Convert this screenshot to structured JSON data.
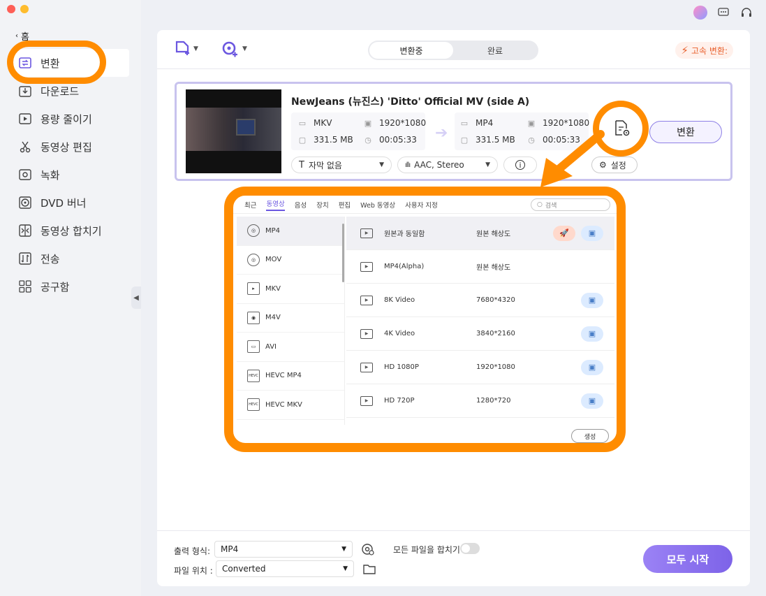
{
  "sidebar": {
    "home_label": "홈",
    "items": [
      {
        "label": "변환",
        "icon": "convert-icon"
      },
      {
        "label": "다운로드",
        "icon": "download-icon"
      },
      {
        "label": "용량 줄이기",
        "icon": "compress-icon"
      },
      {
        "label": "동영상 편집",
        "icon": "scissors-icon"
      },
      {
        "label": "녹화",
        "icon": "record-icon"
      },
      {
        "label": "DVD 버너",
        "icon": "disc-icon"
      },
      {
        "label": "동영상 합치기",
        "icon": "merge-icon"
      },
      {
        "label": "전송",
        "icon": "transfer-icon"
      },
      {
        "label": "공구함",
        "icon": "toolbox-icon"
      }
    ]
  },
  "toolbar": {
    "tabs": [
      "변환중",
      "완료"
    ],
    "turbo_label": "고속 변환:"
  },
  "file": {
    "title": "NewJeans (뉴진스) 'Ditto' Official MV (side A)",
    "source": {
      "format": "MKV",
      "resolution": "1920*1080",
      "size": "331.5 MB",
      "duration": "00:05:33"
    },
    "target": {
      "format": "MP4",
      "resolution": "1920*1080",
      "size": "331.5 MB",
      "duration": "00:05:33"
    },
    "subtitle": "자막 없음",
    "audio": "AAC, Stereo",
    "settings_label": "설정",
    "convert_label": "변환"
  },
  "popup": {
    "tabs": [
      "최근",
      "동영상",
      "음성",
      "장치",
      "편집",
      "Web 동영상",
      "사용자 지정"
    ],
    "active_tab": "동영상",
    "search_placeholder": "검색",
    "formats": [
      "MP4",
      "MOV",
      "MKV",
      "M4V",
      "AVI",
      "HEVC MP4",
      "HEVC MKV"
    ],
    "resolutions": [
      {
        "name": "원본과 동일함",
        "res": "원본 해상도"
      },
      {
        "name": "MP4(Alpha)",
        "res": "원본 해상도"
      },
      {
        "name": "8K Video",
        "res": "7680*4320"
      },
      {
        "name": "4K Video",
        "res": "3840*2160"
      },
      {
        "name": "HD 1080P",
        "res": "1920*1080"
      },
      {
        "name": "HD 720P",
        "res": "1280*720"
      }
    ],
    "create_label": "생성"
  },
  "bottom": {
    "output_label": "출력 형식:",
    "output_value": "MP4",
    "location_label": "파일 위치 :",
    "location_value": "Converted",
    "merge_label": "모든 파일을 합치기",
    "start_label": "모두 시작"
  }
}
